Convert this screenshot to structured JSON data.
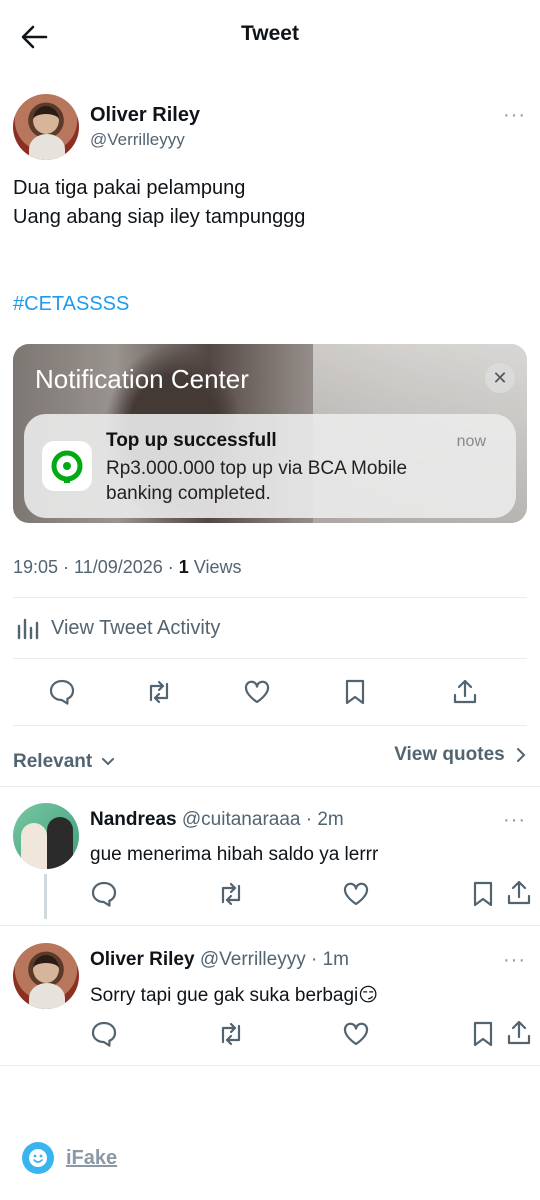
{
  "header": {
    "title": "Tweet"
  },
  "tweet": {
    "author_name": "Oliver Riley",
    "author_handle": "@Verrilleyyy",
    "more": "···",
    "line1": "Dua tiga pakai pelampung",
    "line2": "Uang abang siap iley tampunggg",
    "hashtag": "#CETASSSS",
    "timestamp": "19:05 · 11/09/2026 · ",
    "views_count": "1",
    "views_label": " Views"
  },
  "notification": {
    "header": "Notification Center",
    "close": "✕",
    "title": "Top up successfull",
    "time": "now",
    "body": "Rp3.000.000 top up via BCA Mobile banking completed."
  },
  "activity": {
    "label": "View Tweet Activity"
  },
  "sort": {
    "relevant": "Relevant",
    "view_quotes": "View quotes"
  },
  "replies": [
    {
      "name": "Nandreas",
      "handle": "@cuitanaraaa · 2m",
      "text": "gue menerima hibah saldo ya lerrr",
      "more": "···"
    },
    {
      "name": "Oliver Riley",
      "handle": "@Verrilleyyy · 1m",
      "text": "Sorry tapi gue gak suka berbagi😏",
      "more": "···"
    }
  ],
  "footer": {
    "brand": "iFake"
  },
  "colors": {
    "link": "#1d9bf0",
    "muted": "#536471",
    "icon": "#536471",
    "brand": "#38b5ef"
  }
}
